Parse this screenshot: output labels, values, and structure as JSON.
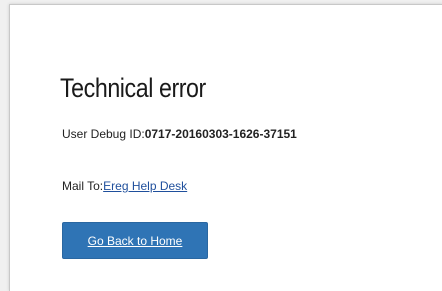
{
  "error": {
    "title": "Technical error",
    "debug_label": "User Debug ID:",
    "debug_id": "0717-20160303-1626-37151",
    "mail_label": "Mail To:",
    "mail_link": "Ereg Help Desk",
    "home_button": "Go Back to Home"
  },
  "colors": {
    "button": "#2f74b5",
    "link": "#1f4f9c"
  }
}
